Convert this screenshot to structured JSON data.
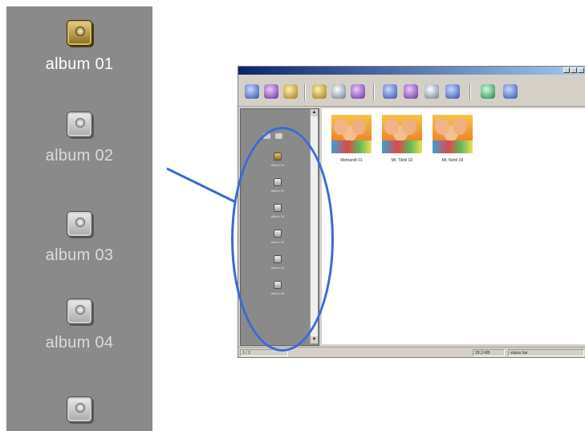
{
  "zoom_strip": {
    "albums": [
      {
        "label": "album 01",
        "active": true
      },
      {
        "label": "album 02",
        "active": false
      },
      {
        "label": "album 03",
        "active": false
      },
      {
        "label": "album 04",
        "active": false
      },
      {
        "label": "",
        "active": false
      }
    ]
  },
  "window": {
    "title": "",
    "toolbar_icons": [
      "globe-icon",
      "color-icon",
      "edit-icon",
      "album-icon",
      "print-icon",
      "disc-icon",
      "tools-icon",
      "wand-icon",
      "eject-icon",
      "search-icon",
      "help-icon",
      "user-icon"
    ]
  },
  "panel": {
    "items": [
      {
        "label": "album 01",
        "active": true
      },
      {
        "label": "album 02",
        "active": false
      },
      {
        "label": "album 03",
        "active": false
      },
      {
        "label": "album 04",
        "active": false
      },
      {
        "label": "album 05",
        "active": false
      },
      {
        "label": "album 06",
        "active": false
      }
    ]
  },
  "thumbnails": [
    {
      "label": "Mehlandt 01"
    },
    {
      "label": "Mt. Tikhil 02"
    },
    {
      "label": "Mt. Nehil 03"
    }
  ],
  "status": {
    "left": "1 / 3",
    "middle": "28,3 MB",
    "right": "status bar"
  },
  "colors": {
    "panel_bg": "#8a8a8a",
    "highlight": "#3a6ad8",
    "title_gradient_start": "#0a246a"
  }
}
